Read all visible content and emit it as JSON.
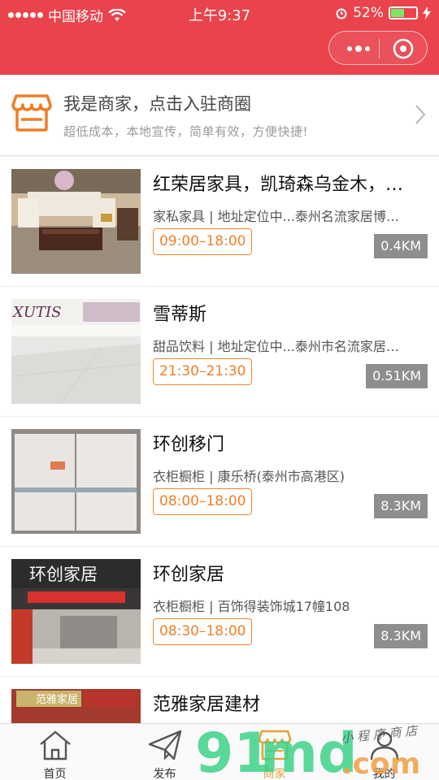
{
  "status_bar": {
    "carrier": "中国移动",
    "time": "上午9:37",
    "battery": "52%",
    "battery_level": 0.52
  },
  "colors": {
    "header_bg": "#e9434c",
    "accent_orange": "#f07f25",
    "distance_badge_bg": "#8e8e8e",
    "active_tab": "#e6a23c"
  },
  "merchant_banner": {
    "icon": "shop-icon",
    "title": "我是商家，点击入驻商圈",
    "subtitle": "超低成本，本地宣传，简单有效，方便快捷!"
  },
  "shops": [
    {
      "name": "红荣居家具，凯琦森乌金木，…",
      "desc": "家私家具 | 地址定位中...泰州名流家居博…",
      "hours": "09:00–18:00",
      "distance": "0.4KM"
    },
    {
      "name": "雪蒂斯",
      "desc": "甜品饮料 | 地址定位中...泰州市名流家居…",
      "hours": "21:30–21:30",
      "distance": "0.51KM"
    },
    {
      "name": "环创移门",
      "desc": "衣柜橱柜 | 康乐桥(泰州市高港区)",
      "hours": "08:00–18:00",
      "distance": "8.3KM"
    },
    {
      "name": "环创家居",
      "desc": "衣柜橱柜 | 百饰得装饰城17幢108",
      "hours": "08:30–18:00",
      "distance": "8.3KM"
    },
    {
      "name": "范雅家居建材",
      "desc": "",
      "hours": "",
      "distance": ""
    }
  ],
  "thumb_text": {
    "shop2_sign": "XUTIS",
    "shop4_sign": "环创家居",
    "shop5_sign": "范雅家居"
  },
  "tabs": [
    {
      "label": "首页",
      "icon": "home-icon"
    },
    {
      "label": "发布",
      "icon": "send-icon"
    },
    {
      "label": "商家",
      "icon": "shop-icon"
    },
    {
      "label": "我的",
      "icon": "user-icon"
    }
  ],
  "watermark": {
    "logo": "91md.com",
    "handwriting": "小程序商店"
  }
}
